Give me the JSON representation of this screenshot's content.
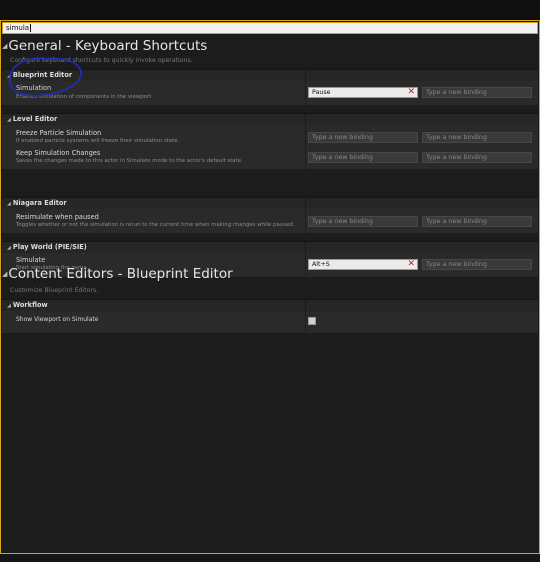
{
  "search": {
    "value": "simula"
  },
  "categories": [
    {
      "title": "General - Keyboard Shortcuts",
      "description": "Configure keyboard shortcuts to quickly invoke operations.",
      "sections": [
        {
          "label": "Blueprint Editor",
          "items": [
            {
              "name": "Simulation",
              "desc": "Enables simulation of components in the viewport",
              "bindings": [
                "Pause",
                "Type a new binding"
              ]
            }
          ]
        },
        {
          "label": "Level Editor",
          "items": [
            {
              "name": "Freeze Particle Simulation",
              "desc": "If enabled particle systems will freeze their simulation state",
              "bindings": [
                "Type a new binding",
                "Type a new binding"
              ]
            },
            {
              "name": "Keep Simulation Changes",
              "desc": "Saves the changes made to this actor in Simulate mode to the actor's default state.",
              "bindings": [
                "Type a new binding",
                "Type a new binding"
              ]
            }
          ]
        },
        {
          "label": "Niagara Editor",
          "items": [
            {
              "name": "Resimulate when paused",
              "desc": "Toggles whether or not the simulation is rerun to the current time when making changes while paused.",
              "bindings": [
                "Type a new binding",
                "Type a new binding"
              ]
            }
          ]
        },
        {
          "label": "Play World (PIE/SIE)",
          "items": [
            {
              "name": "Simulate",
              "desc": "Start simulating the game",
              "bindings": [
                "Alt+S",
                "Type a new binding"
              ]
            }
          ]
        }
      ]
    },
    {
      "title": "Content Editors - Blueprint Editor",
      "description": "Customize Blueprint Editors.",
      "sections": [
        {
          "label": "Workflow",
          "items": [
            {
              "name": "Show Viewport on Simulate",
              "checked": false
            }
          ]
        }
      ]
    }
  ],
  "colors": {
    "accent": "#d6a417",
    "clear_x": "#d21b1b",
    "annotation": "#1d2fb8"
  },
  "icons": {
    "clear": "close-icon",
    "collapse": "triangle-down-icon"
  }
}
